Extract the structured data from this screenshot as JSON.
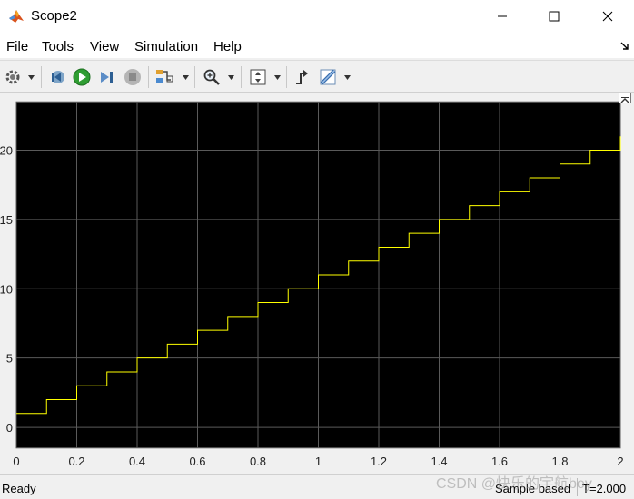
{
  "window": {
    "title": "Scope2"
  },
  "menu": {
    "items": [
      "File",
      "Tools",
      "View",
      "Simulation",
      "Help"
    ]
  },
  "toolbar": {
    "icons": [
      "gear-icon",
      "step-back-icon",
      "run-icon",
      "step-forward-icon",
      "stop-icon",
      "highlight-icon",
      "zoom-icon",
      "autoscale-icon",
      "trigger-icon",
      "cursor-measure-icon"
    ]
  },
  "status": {
    "ready": "Ready",
    "sample": "Sample based",
    "time": "T=2.000"
  },
  "watermark": "CSDN @快乐的宇航boy",
  "colors": {
    "plot_background": "#000000",
    "grid": "#5a5a5a",
    "signal": "#ffff00"
  },
  "chart_data": {
    "type": "line",
    "title": "",
    "xlabel": "",
    "ylabel": "",
    "xlim": [
      0,
      2
    ],
    "ylim": [
      -1.5,
      23.5
    ],
    "grid": true,
    "x_ticks": [
      "0",
      "0.2",
      "0.4",
      "0.6",
      "0.8",
      "1",
      "1.2",
      "1.4",
      "1.6",
      "1.8",
      "2"
    ],
    "y_ticks": [
      "0",
      "5",
      "10",
      "15",
      "20"
    ],
    "series": [
      {
        "style": "stairs",
        "color": "#ffff00",
        "x": [
          0,
          0.1,
          0.2,
          0.3,
          0.4,
          0.5,
          0.6,
          0.7,
          0.8,
          0.9,
          1.0,
          1.1,
          1.2,
          1.3,
          1.4,
          1.5,
          1.6,
          1.7,
          1.8,
          1.9,
          2.0
        ],
        "y": [
          1,
          2,
          3,
          4,
          5,
          6,
          7,
          8,
          9,
          10,
          11,
          12,
          13,
          14,
          15,
          16,
          17,
          18,
          19,
          20,
          21
        ]
      }
    ]
  }
}
